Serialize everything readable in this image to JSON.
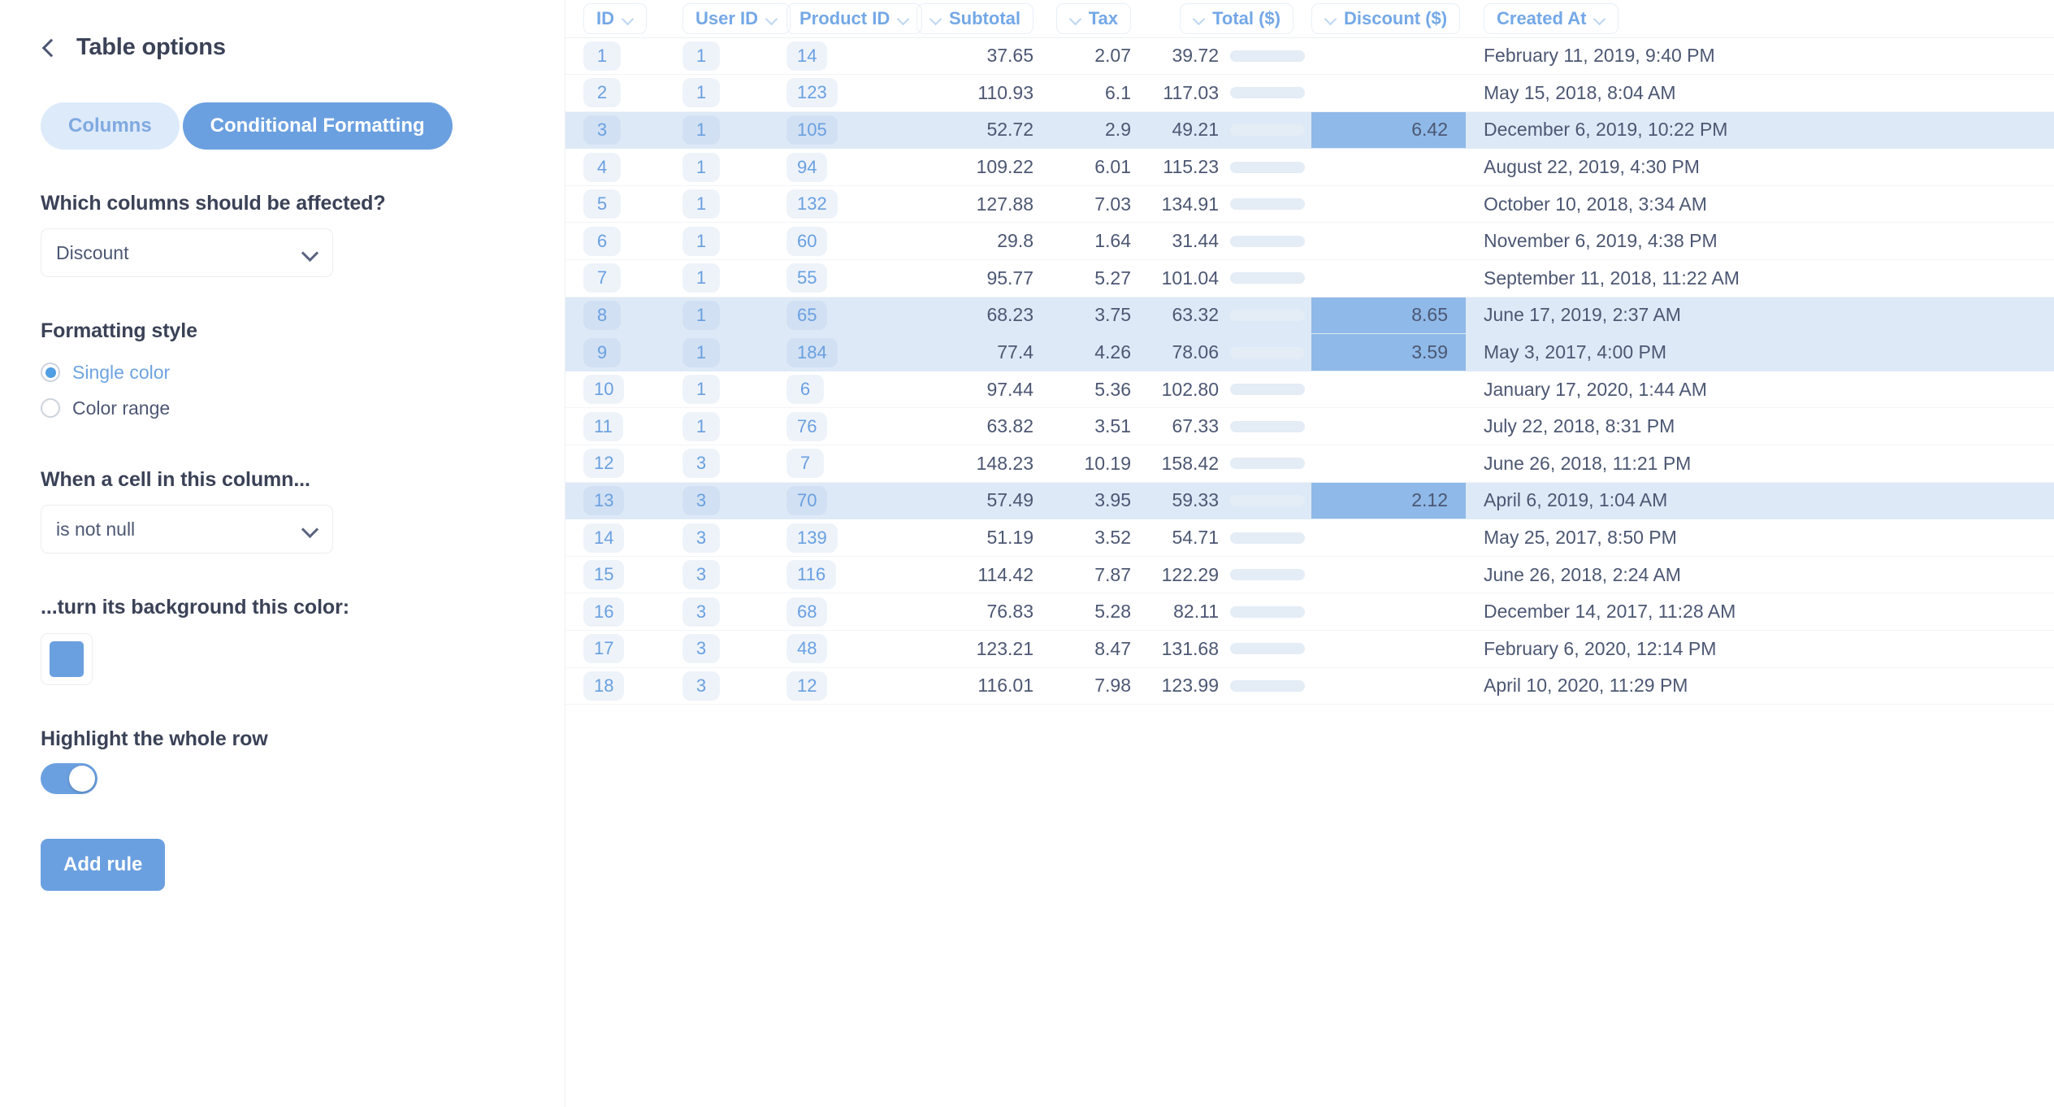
{
  "sidebar": {
    "back_icon": "chevron-left-icon",
    "title": "Table options",
    "tabs": [
      {
        "label": "Columns",
        "active": false
      },
      {
        "label": "Conditional Formatting",
        "active": true
      }
    ],
    "columns_question": "Which columns should be affected?",
    "columns_select_value": "Discount",
    "formatting_style_label": "Formatting style",
    "style_options": [
      {
        "label": "Single color",
        "selected": true
      },
      {
        "label": "Color range",
        "selected": false
      }
    ],
    "when_label": "When a cell in this column...",
    "when_select_value": "is not null",
    "background_label": "...turn its background this color:",
    "background_color": "#6ba0e0",
    "highlight_row_label": "Highlight the whole row",
    "highlight_row_on": true,
    "toggle_color": "#6ba0e0",
    "add_rule_label": "Add rule",
    "add_rule_color": "#6ba0e0"
  },
  "table": {
    "columns": [
      {
        "label": "ID",
        "align": "left",
        "chevron": "right"
      },
      {
        "label": "User ID",
        "align": "left",
        "chevron": "right"
      },
      {
        "label": "Product ID",
        "align": "left",
        "chevron": "right"
      },
      {
        "label": "Subtotal",
        "align": "right",
        "chevron": "left"
      },
      {
        "label": "Tax",
        "align": "right",
        "chevron": "left"
      },
      {
        "label": "Total ($)",
        "align": "right",
        "chevron": "left"
      },
      {
        "label": "Discount ($)",
        "align": "right",
        "chevron": "left"
      },
      {
        "label": "Created At",
        "align": "left",
        "chevron": "right"
      }
    ],
    "bar_max": 160,
    "bar_fill_color": "#5a9ae0",
    "bar_track_color": "#e4ecf6",
    "highlight_row_color": "#dee9f7",
    "discount_cell_color": "#8fb9e8",
    "rows": [
      {
        "id": "1",
        "user_id": "1",
        "product_id": "14",
        "subtotal": "37.65",
        "tax": "2.07",
        "total": "39.72",
        "total_num": 39.72,
        "discount": "",
        "created_at": "February 11, 2019, 9:40 PM",
        "highlight": false
      },
      {
        "id": "2",
        "user_id": "1",
        "product_id": "123",
        "subtotal": "110.93",
        "tax": "6.1",
        "total": "117.03",
        "total_num": 117.03,
        "discount": "",
        "created_at": "May 15, 2018, 8:04 AM",
        "highlight": false
      },
      {
        "id": "3",
        "user_id": "1",
        "product_id": "105",
        "subtotal": "52.72",
        "tax": "2.9",
        "total": "49.21",
        "total_num": 49.21,
        "discount": "6.42",
        "created_at": "December 6, 2019, 10:22 PM",
        "highlight": true
      },
      {
        "id": "4",
        "user_id": "1",
        "product_id": "94",
        "subtotal": "109.22",
        "tax": "6.01",
        "total": "115.23",
        "total_num": 115.23,
        "discount": "",
        "created_at": "August 22, 2019, 4:30 PM",
        "highlight": false
      },
      {
        "id": "5",
        "user_id": "1",
        "product_id": "132",
        "subtotal": "127.88",
        "tax": "7.03",
        "total": "134.91",
        "total_num": 134.91,
        "discount": "",
        "created_at": "October 10, 2018, 3:34 AM",
        "highlight": false
      },
      {
        "id": "6",
        "user_id": "1",
        "product_id": "60",
        "subtotal": "29.8",
        "tax": "1.64",
        "total": "31.44",
        "total_num": 31.44,
        "discount": "",
        "created_at": "November 6, 2019, 4:38 PM",
        "highlight": false
      },
      {
        "id": "7",
        "user_id": "1",
        "product_id": "55",
        "subtotal": "95.77",
        "tax": "5.27",
        "total": "101.04",
        "total_num": 101.04,
        "discount": "",
        "created_at": "September 11, 2018, 11:22 AM",
        "highlight": false
      },
      {
        "id": "8",
        "user_id": "1",
        "product_id": "65",
        "subtotal": "68.23",
        "tax": "3.75",
        "total": "63.32",
        "total_num": 63.32,
        "discount": "8.65",
        "created_at": "June 17, 2019, 2:37 AM",
        "highlight": true
      },
      {
        "id": "9",
        "user_id": "1",
        "product_id": "184",
        "subtotal": "77.4",
        "tax": "4.26",
        "total": "78.06",
        "total_num": 78.06,
        "discount": "3.59",
        "created_at": "May 3, 2017, 4:00 PM",
        "highlight": true
      },
      {
        "id": "10",
        "user_id": "1",
        "product_id": "6",
        "subtotal": "97.44",
        "tax": "5.36",
        "total": "102.80",
        "total_num": 102.8,
        "discount": "",
        "created_at": "January 17, 2020, 1:44 AM",
        "highlight": false
      },
      {
        "id": "11",
        "user_id": "1",
        "product_id": "76",
        "subtotal": "63.82",
        "tax": "3.51",
        "total": "67.33",
        "total_num": 67.33,
        "discount": "",
        "created_at": "July 22, 2018, 8:31 PM",
        "highlight": false
      },
      {
        "id": "12",
        "user_id": "3",
        "product_id": "7",
        "subtotal": "148.23",
        "tax": "10.19",
        "total": "158.42",
        "total_num": 158.42,
        "discount": "",
        "created_at": "June 26, 2018, 11:21 PM",
        "highlight": false
      },
      {
        "id": "13",
        "user_id": "3",
        "product_id": "70",
        "subtotal": "57.49",
        "tax": "3.95",
        "total": "59.33",
        "total_num": 59.33,
        "discount": "2.12",
        "created_at": "April 6, 2019, 1:04 AM",
        "highlight": true
      },
      {
        "id": "14",
        "user_id": "3",
        "product_id": "139",
        "subtotal": "51.19",
        "tax": "3.52",
        "total": "54.71",
        "total_num": 54.71,
        "discount": "",
        "created_at": "May 25, 2017, 8:50 PM",
        "highlight": false
      },
      {
        "id": "15",
        "user_id": "3",
        "product_id": "116",
        "subtotal": "114.42",
        "tax": "7.87",
        "total": "122.29",
        "total_num": 122.29,
        "discount": "",
        "created_at": "June 26, 2018, 2:24 AM",
        "highlight": false
      },
      {
        "id": "16",
        "user_id": "3",
        "product_id": "68",
        "subtotal": "76.83",
        "tax": "5.28",
        "total": "82.11",
        "total_num": 82.11,
        "discount": "",
        "created_at": "December 14, 2017, 11:28 AM",
        "highlight": false
      },
      {
        "id": "17",
        "user_id": "3",
        "product_id": "48",
        "subtotal": "123.21",
        "tax": "8.47",
        "total": "131.68",
        "total_num": 131.68,
        "discount": "",
        "created_at": "February 6, 2020, 12:14 PM",
        "highlight": false
      },
      {
        "id": "18",
        "user_id": "3",
        "product_id": "12",
        "subtotal": "116.01",
        "tax": "7.98",
        "total": "123.99",
        "total_num": 123.99,
        "discount": "",
        "created_at": "April 10, 2020, 11:29 PM",
        "highlight": false
      }
    ]
  }
}
